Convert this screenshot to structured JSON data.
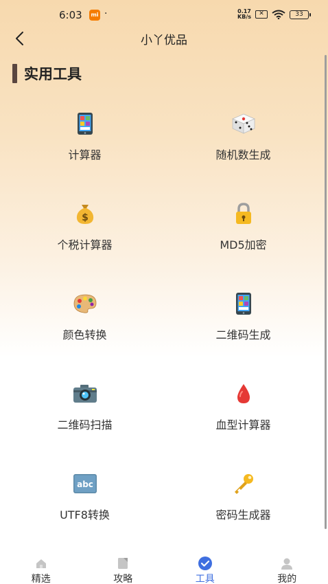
{
  "status_bar": {
    "time": "6:03",
    "app_badge": "mi",
    "dot": "·",
    "net_speed_top": "0.17",
    "net_speed_bottom": "KB/s",
    "sim": "✕",
    "battery": "33"
  },
  "nav": {
    "title": "小丫优品"
  },
  "section": {
    "title": "实用工具"
  },
  "tools": [
    {
      "label": "计算器",
      "icon": "phone-icon"
    },
    {
      "label": "随机数生成",
      "icon": "dice-icon"
    },
    {
      "label": "个税计算器",
      "icon": "money-bag-icon"
    },
    {
      "label": "MD5加密",
      "icon": "lock-icon"
    },
    {
      "label": "颜色转换",
      "icon": "palette-icon"
    },
    {
      "label": "二维码生成",
      "icon": "phone-icon"
    },
    {
      "label": "二维码扫描",
      "icon": "camera-icon"
    },
    {
      "label": "血型计算器",
      "icon": "blood-drop-icon"
    },
    {
      "label": "UTF8转换",
      "icon": "abc-icon"
    },
    {
      "label": "密码生成器",
      "icon": "key-icon"
    }
  ],
  "tab_bar": {
    "tabs": [
      {
        "label": "精选",
        "icon": "home-icon",
        "active": false
      },
      {
        "label": "攻略",
        "icon": "document-icon",
        "active": false
      },
      {
        "label": "工具",
        "icon": "check-circle-icon",
        "active": true
      },
      {
        "label": "我的",
        "icon": "user-icon",
        "active": false
      }
    ]
  },
  "colors": {
    "accent": "#3f6fe0",
    "section_bar": "#5a4640",
    "header_gradient_top": "#f7d9ae"
  }
}
